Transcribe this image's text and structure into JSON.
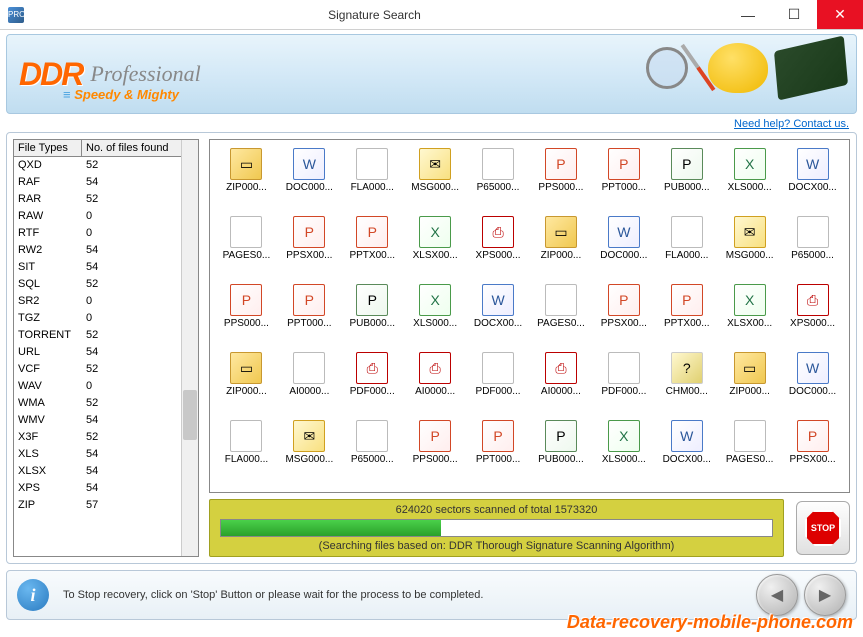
{
  "window": {
    "title": "Signature Search",
    "icon_label": "PRO"
  },
  "banner": {
    "logo": "DDR",
    "subtitle": "Professional",
    "tagline": "Speedy & Mighty"
  },
  "help_link": "Need help? Contact us.",
  "file_types_table": {
    "headers": [
      "File Types",
      "No. of files found"
    ],
    "rows": [
      {
        "type": "QXD",
        "count": 52
      },
      {
        "type": "RAF",
        "count": 54
      },
      {
        "type": "RAR",
        "count": 52
      },
      {
        "type": "RAW",
        "count": 0
      },
      {
        "type": "RTF",
        "count": 0
      },
      {
        "type": "RW2",
        "count": 54
      },
      {
        "type": "SIT",
        "count": 54
      },
      {
        "type": "SQL",
        "count": 52
      },
      {
        "type": "SR2",
        "count": 0
      },
      {
        "type": "TGZ",
        "count": 0
      },
      {
        "type": "TORRENT",
        "count": 52
      },
      {
        "type": "URL",
        "count": 54
      },
      {
        "type": "VCF",
        "count": 52
      },
      {
        "type": "WAV",
        "count": 0
      },
      {
        "type": "WMA",
        "count": 52
      },
      {
        "type": "WMV",
        "count": 54
      },
      {
        "type": "X3F",
        "count": 52
      },
      {
        "type": "XLS",
        "count": 54
      },
      {
        "type": "XLSX",
        "count": 54
      },
      {
        "type": "XPS",
        "count": 54
      },
      {
        "type": "ZIP",
        "count": 57
      }
    ]
  },
  "files": [
    {
      "label": "ZIP000...",
      "kind": "zip"
    },
    {
      "label": "DOC000...",
      "kind": "doc"
    },
    {
      "label": "FLA000...",
      "kind": "blank"
    },
    {
      "label": "MSG000...",
      "kind": "msg"
    },
    {
      "label": "P65000...",
      "kind": "blank"
    },
    {
      "label": "PPS000...",
      "kind": "ppt"
    },
    {
      "label": "PPT000...",
      "kind": "ppt"
    },
    {
      "label": "PUB000...",
      "kind": "pub"
    },
    {
      "label": "XLS000...",
      "kind": "xls"
    },
    {
      "label": "DOCX00...",
      "kind": "doc"
    },
    {
      "label": "PAGES0...",
      "kind": "blank"
    },
    {
      "label": "PPSX00...",
      "kind": "ppt"
    },
    {
      "label": "PPTX00...",
      "kind": "ppt"
    },
    {
      "label": "XLSX00...",
      "kind": "xls"
    },
    {
      "label": "XPS000...",
      "kind": "pdf"
    },
    {
      "label": "ZIP000...",
      "kind": "zip"
    },
    {
      "label": "DOC000...",
      "kind": "doc"
    },
    {
      "label": "FLA000...",
      "kind": "blank"
    },
    {
      "label": "MSG000...",
      "kind": "msg"
    },
    {
      "label": "P65000...",
      "kind": "blank"
    },
    {
      "label": "PPS000...",
      "kind": "ppt"
    },
    {
      "label": "PPT000...",
      "kind": "ppt"
    },
    {
      "label": "PUB000...",
      "kind": "pub"
    },
    {
      "label": "XLS000...",
      "kind": "xls"
    },
    {
      "label": "DOCX00...",
      "kind": "doc"
    },
    {
      "label": "PAGES0...",
      "kind": "blank"
    },
    {
      "label": "PPSX00...",
      "kind": "ppt"
    },
    {
      "label": "PPTX00...",
      "kind": "ppt"
    },
    {
      "label": "XLSX00...",
      "kind": "xls"
    },
    {
      "label": "XPS000...",
      "kind": "pdf"
    },
    {
      "label": "ZIP000...",
      "kind": "zip"
    },
    {
      "label": "AI0000...",
      "kind": "blank"
    },
    {
      "label": "PDF000...",
      "kind": "pdf"
    },
    {
      "label": "AI0000...",
      "kind": "pdf"
    },
    {
      "label": "PDF000...",
      "kind": "blank"
    },
    {
      "label": "AI0000...",
      "kind": "pdf"
    },
    {
      "label": "PDF000...",
      "kind": "blank"
    },
    {
      "label": "CHM00...",
      "kind": "chm"
    },
    {
      "label": "ZIP000...",
      "kind": "zip"
    },
    {
      "label": "DOC000...",
      "kind": "doc"
    },
    {
      "label": "FLA000...",
      "kind": "blank"
    },
    {
      "label": "MSG000...",
      "kind": "msg"
    },
    {
      "label": "P65000...",
      "kind": "blank"
    },
    {
      "label": "PPS000...",
      "kind": "ppt"
    },
    {
      "label": "PPT000...",
      "kind": "ppt"
    },
    {
      "label": "PUB000...",
      "kind": "pub"
    },
    {
      "label": "XLS000...",
      "kind": "xls"
    },
    {
      "label": "DOCX00...",
      "kind": "doc"
    },
    {
      "label": "PAGES0...",
      "kind": "blank"
    },
    {
      "label": "PPSX00...",
      "kind": "ppt"
    }
  ],
  "progress": {
    "scanned": 624020,
    "total": 1573320,
    "text": "624020 sectors scanned of total 1573320",
    "subtext": "(Searching files based on:  DDR Thorough Signature Scanning Algorithm)",
    "percent": 40
  },
  "stop_label": "STOP",
  "info_text": "To Stop recovery, click on 'Stop' Button or please wait for the process to be completed.",
  "watermark": "Data-recovery-mobile-phone.com"
}
